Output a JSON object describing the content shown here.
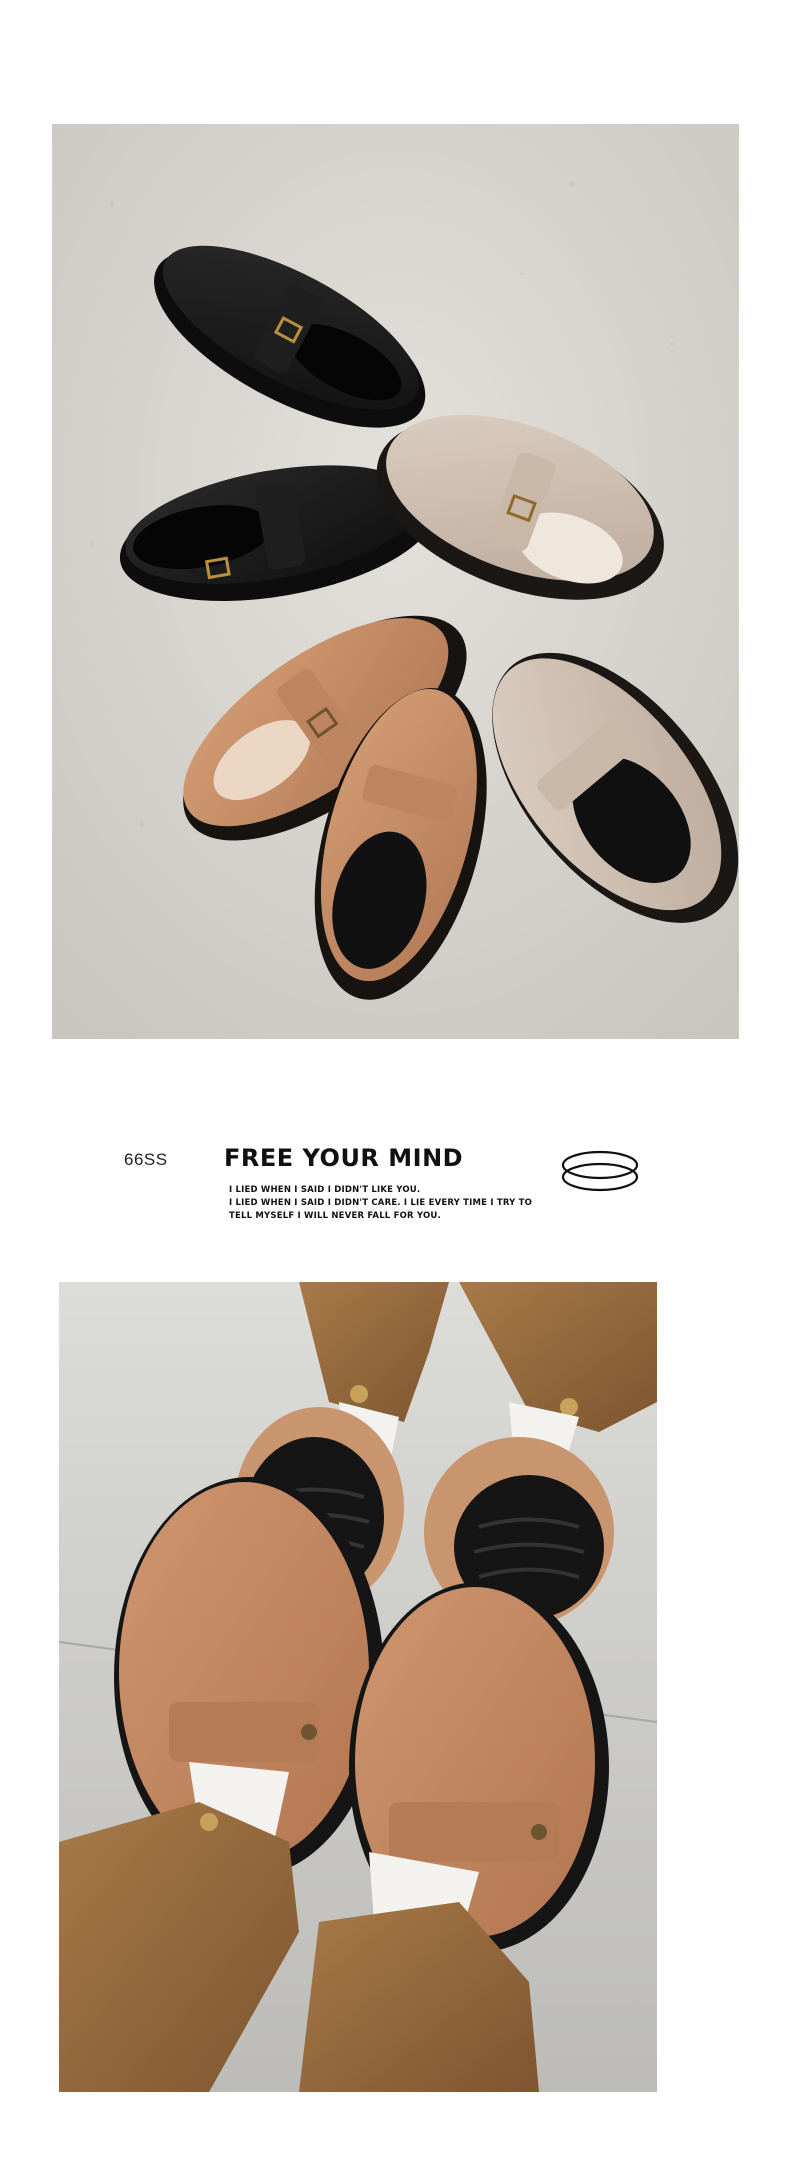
{
  "top_photo": {
    "alt": "Flat lay of black, tan and beige buckle clogs on textured concrete"
  },
  "tagline": {
    "season": "66SS",
    "headline": "FREE YOUR MIND",
    "lines": [
      "I LIED WHEN I SAID I DIDN'T LIKE YOU.",
      "I LIED WHEN I SAID I DIDN'T CARE. I LIE EVERY TIME I TRY TO",
      "TELL MYSELF I WILL NEVER FALL FOR YOU."
    ],
    "icon": "double-ring-icon"
  },
  "bottom_photo": {
    "alt": "Feet in white socks wearing tan buckle clogs with brown trousers"
  },
  "colors": {
    "black_shoe": "#1a1a1a",
    "tan_shoe": "#c48a63",
    "beige_shoe": "#cdbcae",
    "floor": "#d9d6d1",
    "trousers": "#9a6b3d"
  }
}
